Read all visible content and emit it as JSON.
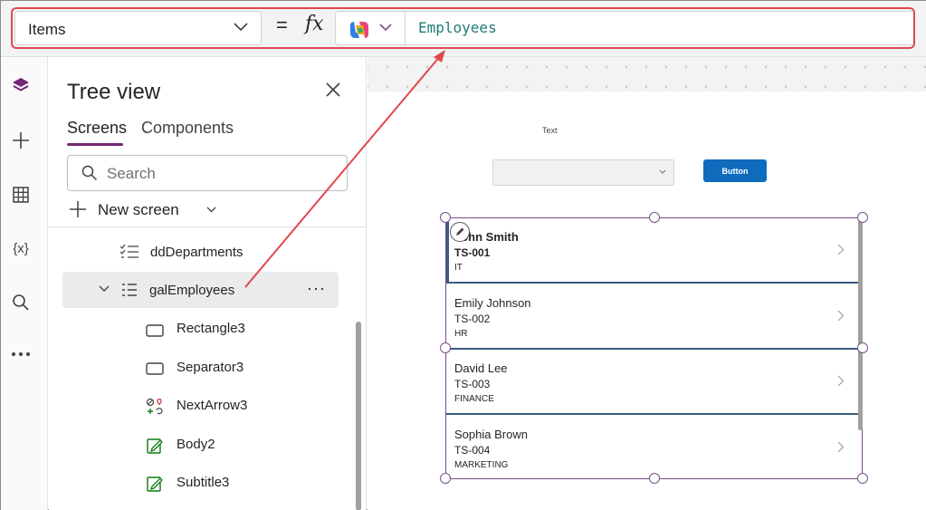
{
  "formula_bar": {
    "property": "Items",
    "equals": "=",
    "fx": "fx",
    "formula": "Employees"
  },
  "tree_view": {
    "title": "Tree view",
    "tabs": [
      "Screens",
      "Components"
    ],
    "search_placeholder": "Search",
    "new_screen_label": "New screen",
    "nodes": {
      "dd_departments": "ddDepartments",
      "gal_employees": "galEmployees",
      "more": "···",
      "children": [
        "Rectangle3",
        "Separator3",
        "NextArrow3",
        "Body2",
        "Subtitle3"
      ]
    }
  },
  "canvas": {
    "text_label": "Text",
    "button_label": "Button",
    "gallery_items": [
      {
        "title": "John Smith",
        "subtitle": "TS-001",
        "body": "IT"
      },
      {
        "title": "Emily Johnson",
        "subtitle": "TS-002",
        "body": "HR"
      },
      {
        "title": "David Lee",
        "subtitle": "TS-003",
        "body": "FINANCE"
      },
      {
        "title": "Sophia Brown",
        "subtitle": "TS-004",
        "body": "MARKETING"
      }
    ]
  },
  "icons": {
    "rail": [
      "layers-icon",
      "plus-icon",
      "table-icon",
      "variables-icon",
      "search-icon",
      "more-icon"
    ]
  },
  "colors": {
    "accent": "#742774",
    "formula_text": "#1e7b74",
    "annotation": "#e0484b",
    "button": "#0f6cbd",
    "selection": "#7a4f8a"
  }
}
